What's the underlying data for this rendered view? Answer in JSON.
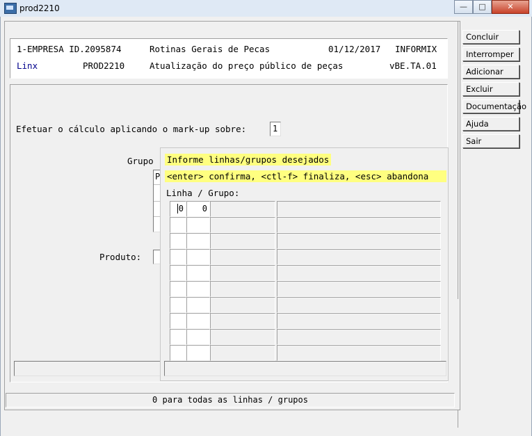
{
  "window": {
    "title": "prod2210",
    "minimize": "—",
    "maximize": "□",
    "close": "✕"
  },
  "header": {
    "line1_left": "1-EMPRESA ID.2095874",
    "line1_center": "Rotinas Gerais de Pecas",
    "line1_date": "01/12/2017",
    "line1_right": "INFORMIX",
    "line2_left": "Linx",
    "line2_code": "PROD2210",
    "line2_center": "Atualização do preço público de peças",
    "line2_right": "vBE.TA.01"
  },
  "form": {
    "markup_label": "Efetuar o cálculo aplicando o mark-up sobre:",
    "markup_value": "1",
    "grupo_label": "Grupo",
    "grupo_peek": "P",
    "produto_label": "Produto:"
  },
  "popup": {
    "line1": "Informe linhas/grupos desejados",
    "line2": "<enter> confirma, <ctl-f> finaliza, <esc> abandona",
    "grid_label": "Linha / Grupo:",
    "first_row": [
      "0",
      "0"
    ]
  },
  "buttons": [
    {
      "label": "Concluir"
    },
    {
      "label": "Interromper"
    },
    {
      "label": "Adicionar"
    },
    {
      "label": "Excluir"
    },
    {
      "label": "Documentação"
    },
    {
      "label": "Ajuda"
    },
    {
      "label": "Sair"
    }
  ],
  "status": {
    "message": "0 para todas as linhas / grupos"
  }
}
